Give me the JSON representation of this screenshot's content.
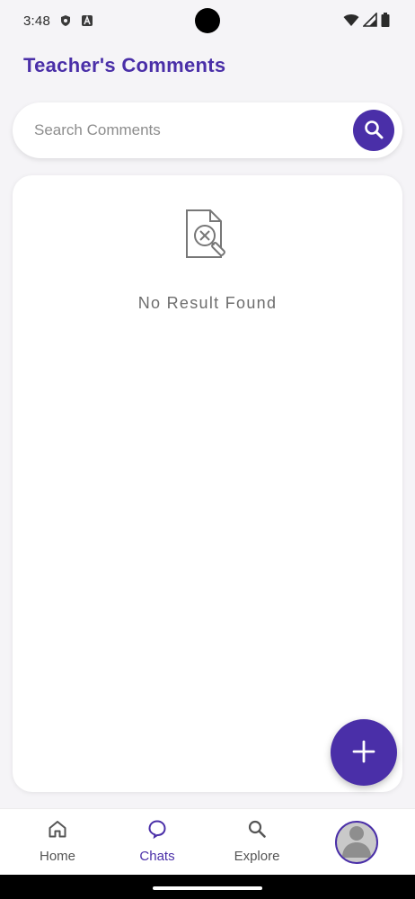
{
  "status_bar": {
    "time": "3:48",
    "icons": [
      "shield-icon",
      "font-a-icon",
      "wifi-icon",
      "signal-icon",
      "battery-icon"
    ]
  },
  "header": {
    "title": "Teacher's Comments"
  },
  "search": {
    "placeholder": "Search Comments",
    "value": "",
    "icon": "search-icon"
  },
  "content": {
    "empty_icon": "document-x-magnifier-icon",
    "empty_message": "No Result Found"
  },
  "fab": {
    "icon": "plus-icon"
  },
  "bottom_nav": {
    "items": [
      {
        "label": "Home",
        "icon": "home-icon",
        "active": false
      },
      {
        "label": "Chats",
        "icon": "chat-bubble-icon",
        "active": true
      },
      {
        "label": "Explore",
        "icon": "search-icon",
        "active": false
      }
    ],
    "avatar_icon": "user-avatar-icon"
  },
  "colors": {
    "primary": "#4a2fa8",
    "background": "#f5f4f7",
    "card": "#ffffff",
    "muted_text": "#6d6d6d"
  }
}
